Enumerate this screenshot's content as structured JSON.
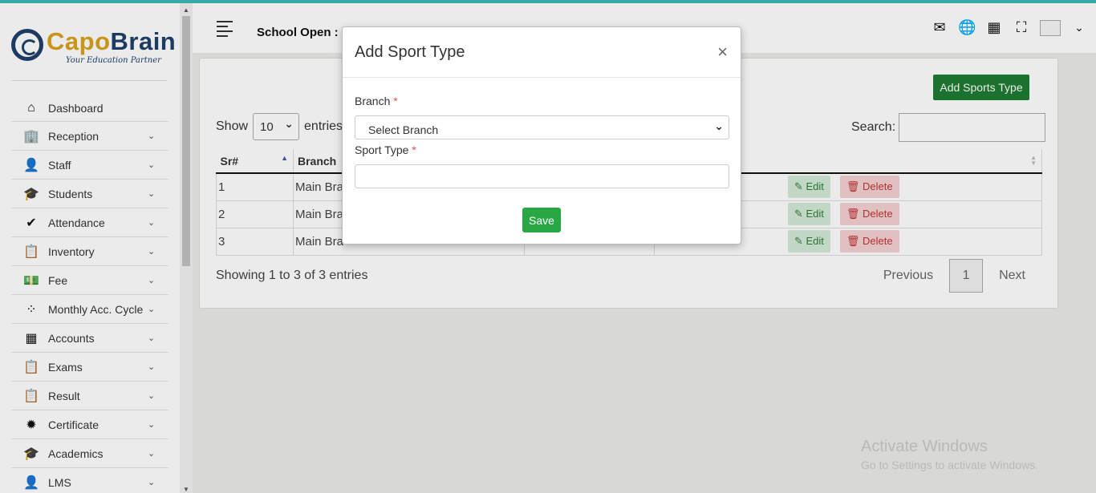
{
  "brand": {
    "part1": "Capo",
    "part2": "Brain",
    "tagline": "Your Education Partner"
  },
  "sidebar": {
    "items": [
      {
        "label": "Dashboard",
        "icon": "home-icon",
        "glyph": "⌂",
        "expandable": false
      },
      {
        "label": "Reception",
        "icon": "reception-icon",
        "glyph": "🏢",
        "expandable": true
      },
      {
        "label": "Staff",
        "icon": "staff-icon",
        "glyph": "👤",
        "expandable": true
      },
      {
        "label": "Students",
        "icon": "students-icon",
        "glyph": "🎓",
        "expandable": true
      },
      {
        "label": "Attendance",
        "icon": "check-icon",
        "glyph": "✔",
        "expandable": true
      },
      {
        "label": "Inventory",
        "icon": "clipboard-icon",
        "glyph": "📋",
        "expandable": true
      },
      {
        "label": "Fee",
        "icon": "money-icon",
        "glyph": "💵",
        "expandable": true
      },
      {
        "label": "Monthly Acc. Cycle",
        "icon": "spinner-icon",
        "glyph": "⁘",
        "expandable": true
      },
      {
        "label": "Accounts",
        "icon": "calculator-icon",
        "glyph": "▦",
        "expandable": true
      },
      {
        "label": "Exams",
        "icon": "clipboard-icon",
        "glyph": "📋",
        "expandable": true
      },
      {
        "label": "Result",
        "icon": "clipboard-icon",
        "glyph": "📋",
        "expandable": true
      },
      {
        "label": "Certificate",
        "icon": "certificate-icon",
        "glyph": "✹",
        "expandable": true
      },
      {
        "label": "Academics",
        "icon": "graduation-cap-icon",
        "glyph": "🎓",
        "expandable": true
      },
      {
        "label": "LMS",
        "icon": "lms-icon",
        "glyph": "👤",
        "expandable": true
      }
    ]
  },
  "header": {
    "school_open": "School Open :"
  },
  "card": {
    "add_button": "Add Sports Type",
    "show_label": "Show",
    "entries_label": "entries",
    "page_size": "10",
    "search_label": "Search:",
    "columns": [
      "Sr#",
      "Branch"
    ],
    "rows": [
      {
        "sr": "1",
        "branch": "Main Bra"
      },
      {
        "sr": "2",
        "branch": "Main Bra"
      },
      {
        "sr": "3",
        "branch": "Main Bra"
      }
    ],
    "edit_label": "Edit",
    "delete_label": "Delete",
    "showing": "Showing 1 to 3 of 3 entries",
    "prev": "Previous",
    "page": "1",
    "next": "Next"
  },
  "modal": {
    "title": "Add Sport Type",
    "close": "×",
    "branch_label": "Branch",
    "branch_placeholder": "Select Branch",
    "sport_type_label": "Sport Type",
    "required_mark": "*",
    "save": "Save"
  },
  "watermark": {
    "line1": "Activate Windows",
    "line2": "Go to Settings to activate Windows."
  },
  "colors": {
    "accent": "#3ab7b7",
    "primary_button": "#1e7b32",
    "save_button": "#28a745",
    "brand_gold": "#d9a21b",
    "brand_navy": "#1f3f6b"
  }
}
